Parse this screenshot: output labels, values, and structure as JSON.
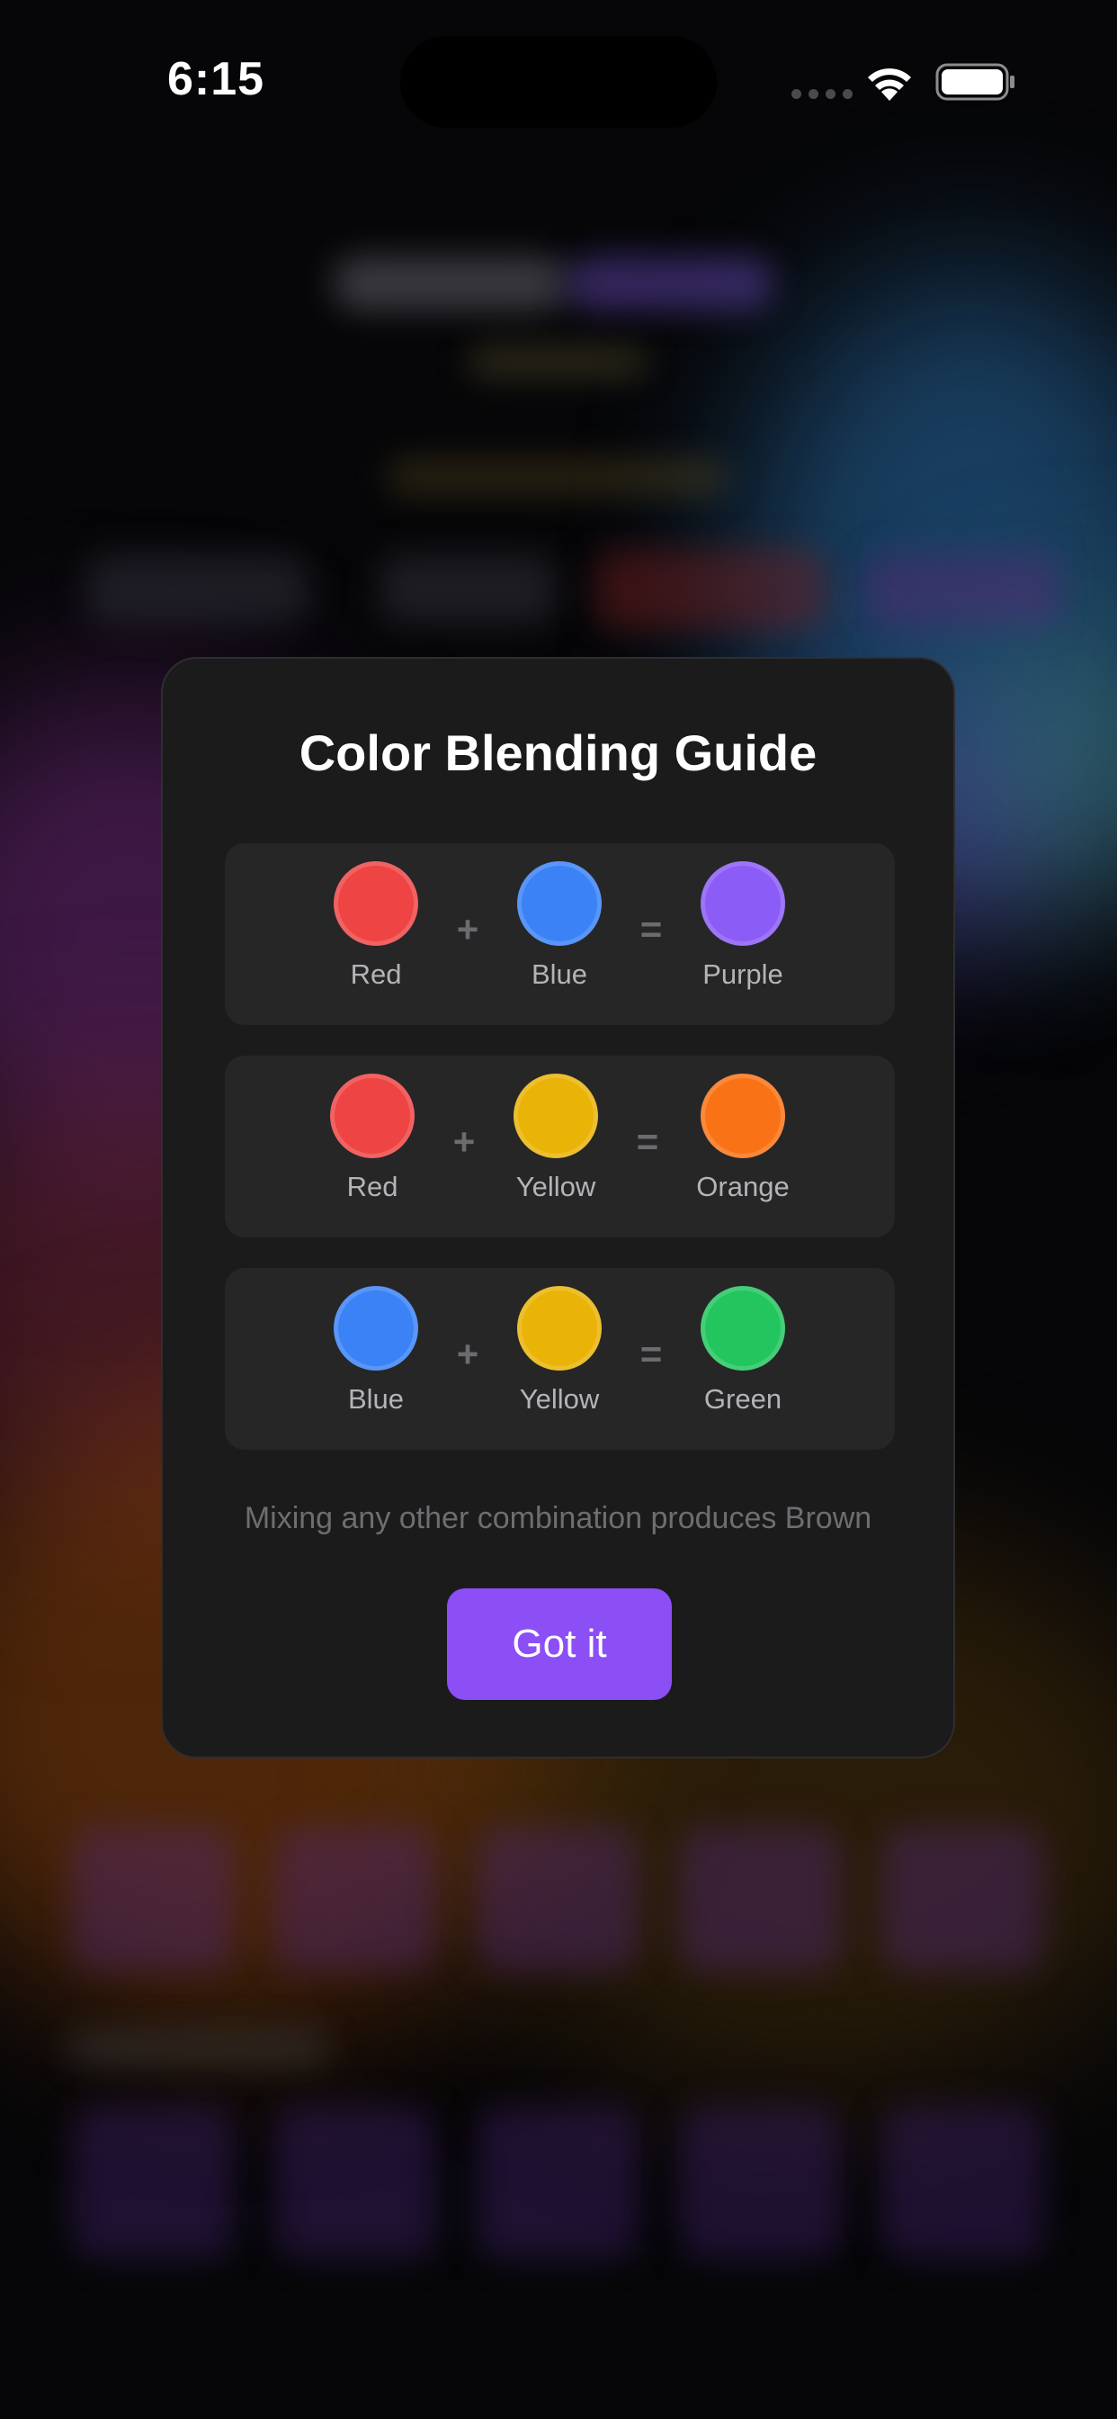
{
  "status_bar": {
    "time": "6:15",
    "icons": [
      "signal-icon",
      "wifi-icon",
      "battery-icon"
    ]
  },
  "modal": {
    "title": "Color Blending Guide",
    "combos": [
      {
        "first": {
          "name": "Red",
          "color": "#ef4444"
        },
        "second": {
          "name": "Blue",
          "color": "#3b82f6"
        },
        "result": {
          "name": "Purple",
          "color": "#8b5cf6"
        },
        "plus": "+",
        "equals": "="
      },
      {
        "first": {
          "name": "Red",
          "color": "#ef4444"
        },
        "second": {
          "name": "Yellow",
          "color": "#eab308"
        },
        "result": {
          "name": "Orange",
          "color": "#f97316"
        },
        "plus": "+",
        "equals": "="
      },
      {
        "first": {
          "name": "Blue",
          "color": "#3b82f6"
        },
        "second": {
          "name": "Yellow",
          "color": "#eab308"
        },
        "result": {
          "name": "Green",
          "color": "#22c55e"
        },
        "plus": "+",
        "equals": "="
      }
    ],
    "hint": "Mixing any other combination produces Brown",
    "button_label": "Got it",
    "colors": {
      "card": "#1b1b1c",
      "row": "#262627",
      "accent": "#8b4ff5"
    }
  }
}
